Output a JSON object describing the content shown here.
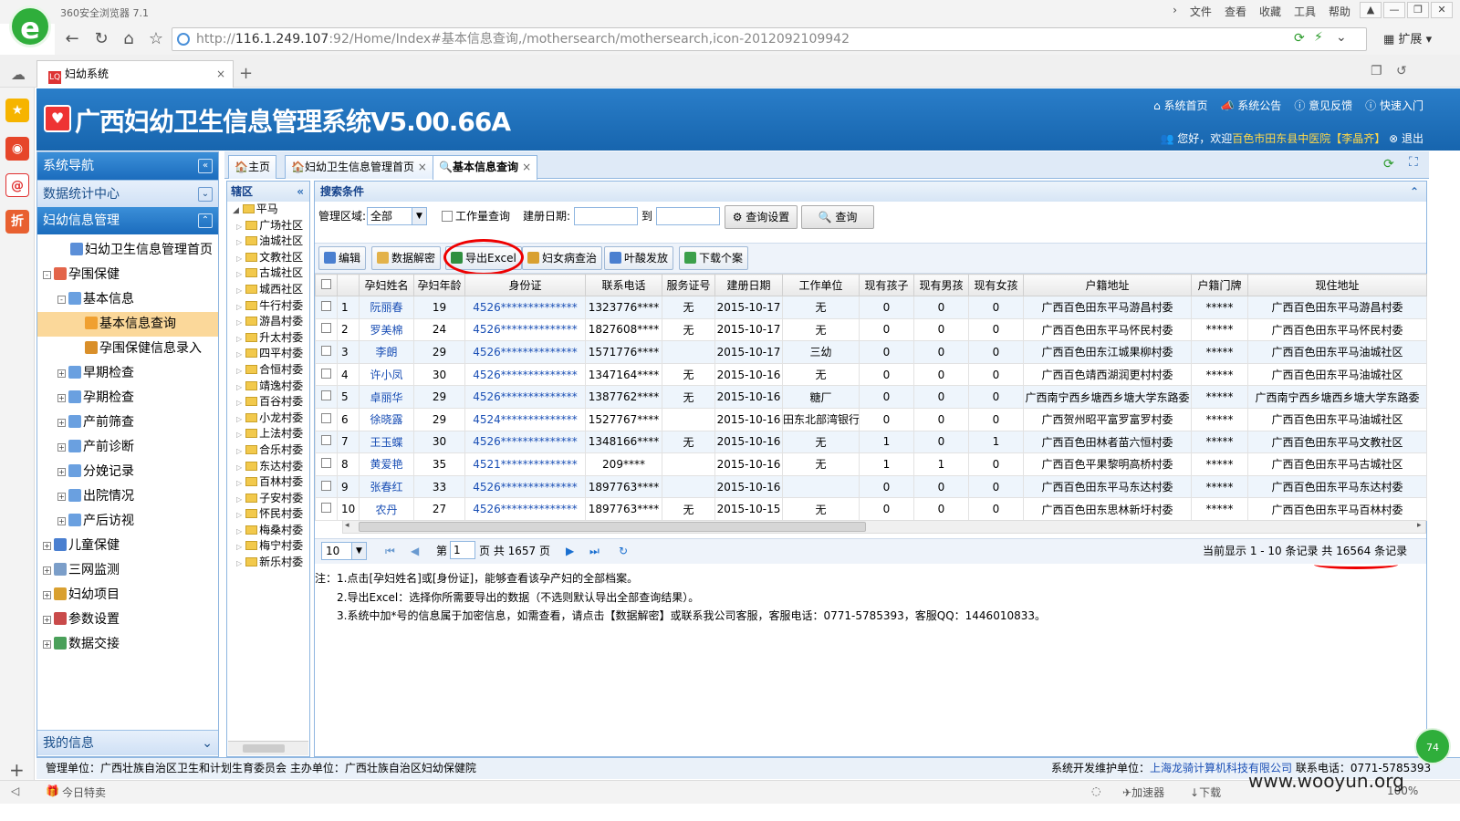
{
  "browser": {
    "name": "360安全浏览器 7.1",
    "menus": [
      "文件",
      "查看",
      "收藏",
      "工具",
      "帮助"
    ],
    "url_host": "116.1.249.107",
    "url_full": ":92/Home/Index#基本信息查询,/mothersearch/mothersearch,icon-2012092109942",
    "url_scheme": "http://",
    "ext_label": "扩展",
    "tab_title": "妇幼系统",
    "favicon_text": "LQ",
    "logo_char": "e"
  },
  "app": {
    "title": "广西妇幼卫生信息管理系统V5.00.66A",
    "links": [
      "系统首页",
      "系统公告",
      "意见反馈",
      "快速入门"
    ],
    "welcome_prefix": "您好，欢迎",
    "welcome_org": "百色市田东县中医院",
    "welcome_user": "【李晶齐】",
    "logout": "退出"
  },
  "nav": {
    "title": "系统导航",
    "stats": "数据统计中心",
    "mgmt": "妇幼信息管理",
    "my_info": "我的信息",
    "tree": [
      {
        "label": "妇幼卫生信息管理首页",
        "lvl": 1,
        "pm": "",
        "c": "#5b8fd8"
      },
      {
        "label": "孕围保健",
        "lvl": 0,
        "pm": "-",
        "c": "#e3654a"
      },
      {
        "label": "基本信息",
        "lvl": 1,
        "pm": "-",
        "c": "#6aa0e0"
      },
      {
        "label": "基本信息查询",
        "lvl": 2,
        "pm": "",
        "c": "#f0a030",
        "sel": true
      },
      {
        "label": "孕围保健信息录入",
        "lvl": 2,
        "pm": "",
        "c": "#d98f2a"
      },
      {
        "label": "早期检查",
        "lvl": 1,
        "pm": "+",
        "c": "#6aa0e0"
      },
      {
        "label": "孕期检查",
        "lvl": 1,
        "pm": "+",
        "c": "#6aa0e0"
      },
      {
        "label": "产前筛查",
        "lvl": 1,
        "pm": "+",
        "c": "#6aa0e0"
      },
      {
        "label": "产前诊断",
        "lvl": 1,
        "pm": "+",
        "c": "#6aa0e0"
      },
      {
        "label": "分娩记录",
        "lvl": 1,
        "pm": "+",
        "c": "#6aa0e0"
      },
      {
        "label": "出院情况",
        "lvl": 1,
        "pm": "+",
        "c": "#6aa0e0"
      },
      {
        "label": "产后访视",
        "lvl": 1,
        "pm": "+",
        "c": "#6aa0e0"
      },
      {
        "label": "儿童保健",
        "lvl": 0,
        "pm": "+",
        "c": "#4a7fd0"
      },
      {
        "label": "三网监测",
        "lvl": 0,
        "pm": "+",
        "c": "#7b9ec9"
      },
      {
        "label": "妇幼项目",
        "lvl": 0,
        "pm": "+",
        "c": "#d9a030"
      },
      {
        "label": "参数设置",
        "lvl": 0,
        "pm": "+",
        "c": "#c94a4a"
      },
      {
        "label": "数据交接",
        "lvl": 0,
        "pm": "+",
        "c": "#4aa05a"
      }
    ]
  },
  "pagetabs": [
    "主页",
    "妇幼卫生信息管理首页",
    "基本信息查询"
  ],
  "region": {
    "title": "辖区",
    "root": "平马",
    "items": [
      "广场社区",
      "油城社区",
      "文教社区",
      "古城社区",
      "城西社区",
      "牛行村委",
      "游昌村委",
      "升太村委",
      "四平村委",
      "合恒村委",
      "靖逸村委",
      "百谷村委",
      "小龙村委",
      "上法村委",
      "合乐村委",
      "东达村委",
      "百林村委",
      "子安村委",
      "怀民村委",
      "梅桑村委",
      "梅宁村委",
      "新乐村委"
    ]
  },
  "search": {
    "title": "搜索条件",
    "area_label": "管理区域:",
    "area_value": "全部",
    "workload": "工作量查询",
    "date_label": "建册日期:",
    "to": "到",
    "settings_btn": "查询设置",
    "query_btn": "查询"
  },
  "toolbar": [
    "编辑",
    "数据解密",
    "导出Excel",
    "妇女病查治",
    "叶酸发放",
    "下载个案"
  ],
  "grid": {
    "headers": [
      "",
      "",
      "孕妇姓名",
      "孕妇年龄",
      "身份证",
      "联系电话",
      "服务证号",
      "建册日期",
      "工作单位",
      "现有孩子",
      "现有男孩",
      "现有女孩",
      "户籍地址",
      "户籍门牌",
      "现住地址"
    ],
    "rows": [
      [
        "1",
        "阮丽春",
        "19",
        "4526**************",
        "1323776****",
        "无",
        "2015-10-17",
        "无",
        "0",
        "0",
        "0",
        "广西百色田东平马游昌村委",
        "*****",
        "广西百色田东平马游昌村委"
      ],
      [
        "2",
        "罗美棉",
        "24",
        "4526**************",
        "1827608****",
        "无",
        "2015-10-17",
        "无",
        "0",
        "0",
        "0",
        "广西百色田东平马怀民村委",
        "*****",
        "广西百色田东平马怀民村委"
      ],
      [
        "3",
        "李朗",
        "29",
        "4526**************",
        "1571776****",
        "",
        "2015-10-17",
        "三幼",
        "0",
        "0",
        "0",
        "广西百色田东江城果柳村委",
        "*****",
        "广西百色田东平马油城社区"
      ],
      [
        "4",
        "许小凤",
        "30",
        "4526**************",
        "1347164****",
        "无",
        "2015-10-16",
        "无",
        "0",
        "0",
        "0",
        "广西百色靖西湖润更村村委",
        "*****",
        "广西百色田东平马油城社区"
      ],
      [
        "5",
        "卓丽华",
        "29",
        "4526**************",
        "1387762****",
        "无",
        "2015-10-16",
        "糖厂",
        "0",
        "0",
        "0",
        "广西南宁西乡塘西乡塘大学东路委",
        "*****",
        "广西南宁西乡塘西乡塘大学东路委"
      ],
      [
        "6",
        "徐晓露",
        "29",
        "4524**************",
        "1527767****",
        "",
        "2015-10-16",
        "田东北部湾银行",
        "0",
        "0",
        "0",
        "广西贺州昭平富罗富罗村委",
        "*****",
        "广西百色田东平马油城社区"
      ],
      [
        "7",
        "王玉蝶",
        "30",
        "4526**************",
        "1348166****",
        "无",
        "2015-10-16",
        "无",
        "1",
        "0",
        "1",
        "广西百色田林者苗六恒村委",
        "*****",
        "广西百色田东平马文教社区"
      ],
      [
        "8",
        "黄爱艳",
        "35",
        "4521**************",
        "209****",
        "",
        "2015-10-16",
        "无",
        "1",
        "1",
        "0",
        "广西百色平果黎明高桥村委",
        "*****",
        "广西百色田东平马古城社区"
      ],
      [
        "9",
        "张春红",
        "33",
        "4526**************",
        "1897763****",
        "",
        "2015-10-16",
        "",
        "0",
        "0",
        "0",
        "广西百色田东平马东达村委",
        "*****",
        "广西百色田东平马东达村委"
      ],
      [
        "10",
        "农丹",
        "27",
        "4526**************",
        "1897763****",
        "无",
        "2015-10-15",
        "无",
        "0",
        "0",
        "0",
        "广西百色田东思林新圩村委",
        "*****",
        "广西百色田东平马百林村委"
      ]
    ]
  },
  "pager": {
    "page_size": "10",
    "page_label": "第",
    "page": "1",
    "total_pages": "页 共 1657 页",
    "summary_prefix": "当前显示 1 - 10 条记录 共 ",
    "total": "16564",
    "summary_suffix": " 条记录"
  },
  "notes": [
    "注：1.点击[孕妇姓名]或[身份证]，能够查看该孕产妇的全部档案。",
    "2.导出Excel：选择你所需要导出的数据（不选则默认导出全部查询结果）。",
    "3.系统中加*号的信息属于加密信息，如需查看，请点击【数据解密】或联系我公司客服，客服电话：0771-5785393，客服QQ：1446010833。"
  ],
  "footer": {
    "left": "管理单位：广西壮族自治区卫生和计划生育委员会   主办单位：广西壮族自治区妇幼保健院",
    "dev_label": "系统开发维护单位：",
    "dev_org": "上海龙骑计算机科技有限公司",
    "phone": "联系电话：0771-5785393"
  },
  "statusbar": {
    "left": "今日特卖",
    "accel": "加速器",
    "download": "下载",
    "zoom": "100%"
  },
  "side_badge": "74",
  "watermark": "www.wooyun.org"
}
